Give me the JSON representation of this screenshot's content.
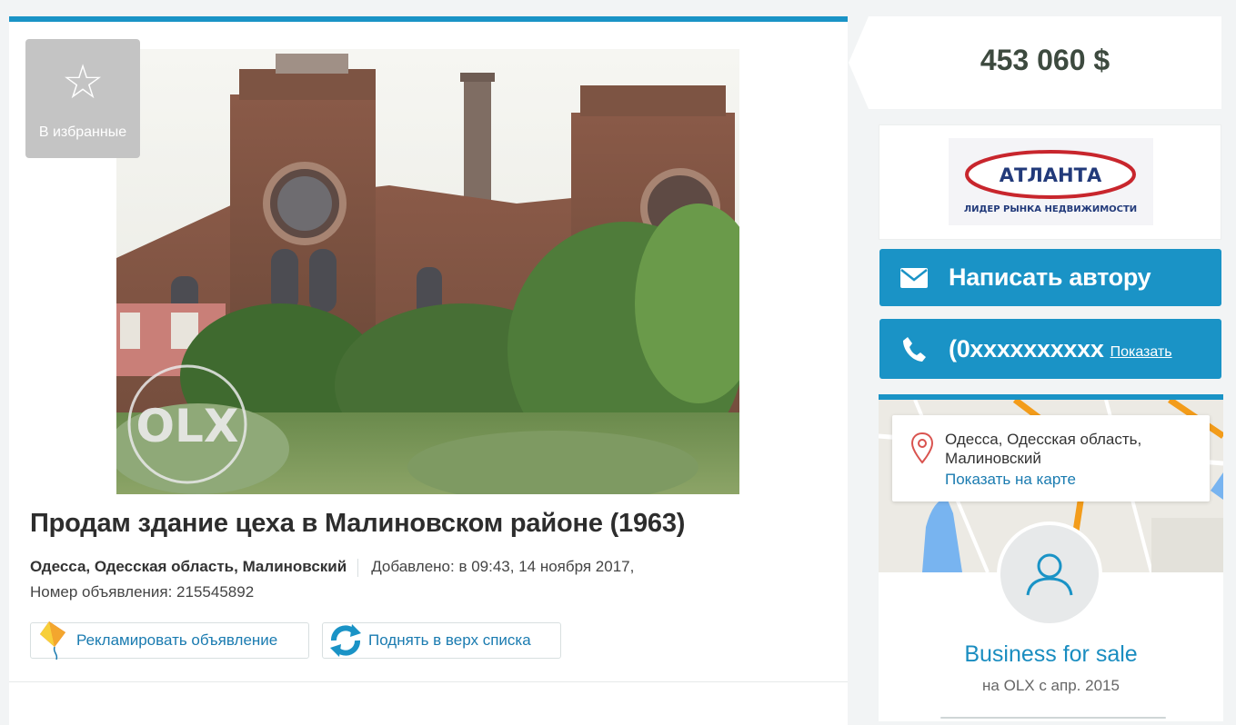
{
  "favorite": {
    "label": "В избранные",
    "icon": "star-outline-icon"
  },
  "listing": {
    "title": "Продам здание цеха в Малиновском районе (1963)",
    "location": "Одесса, Одесская область, Малиновский",
    "added": "Добавлено: в 09:43, 14 ноября 2017,",
    "ad_number": "Номер объявления: 215545892",
    "photo_watermark": "OLX"
  },
  "actions": {
    "promote_label": "Рекламировать объявление",
    "bump_label": "Поднять в верх списка"
  },
  "sidebar": {
    "price": "453 060 $",
    "agency_logo": {
      "name": "АТЛАНТА",
      "tagline": "ЛИДЕР РЫНКА НЕДВИЖИМОСТИ"
    },
    "message_button": "Написать автору",
    "phone": {
      "number": "(0xxxxxxxxxx",
      "show_label": "Показать"
    },
    "map": {
      "address": "Одесса, Одесская область, Малиновский",
      "show_on_map": "Показать на карте"
    },
    "seller": {
      "name": "Business for sale",
      "since": "на OLX с апр. 2015"
    }
  },
  "colors": {
    "accent": "#1a93c6",
    "link": "#1a7bb0",
    "favorite_bg": "#c4c4c4",
    "background": "#f2f4f5"
  }
}
